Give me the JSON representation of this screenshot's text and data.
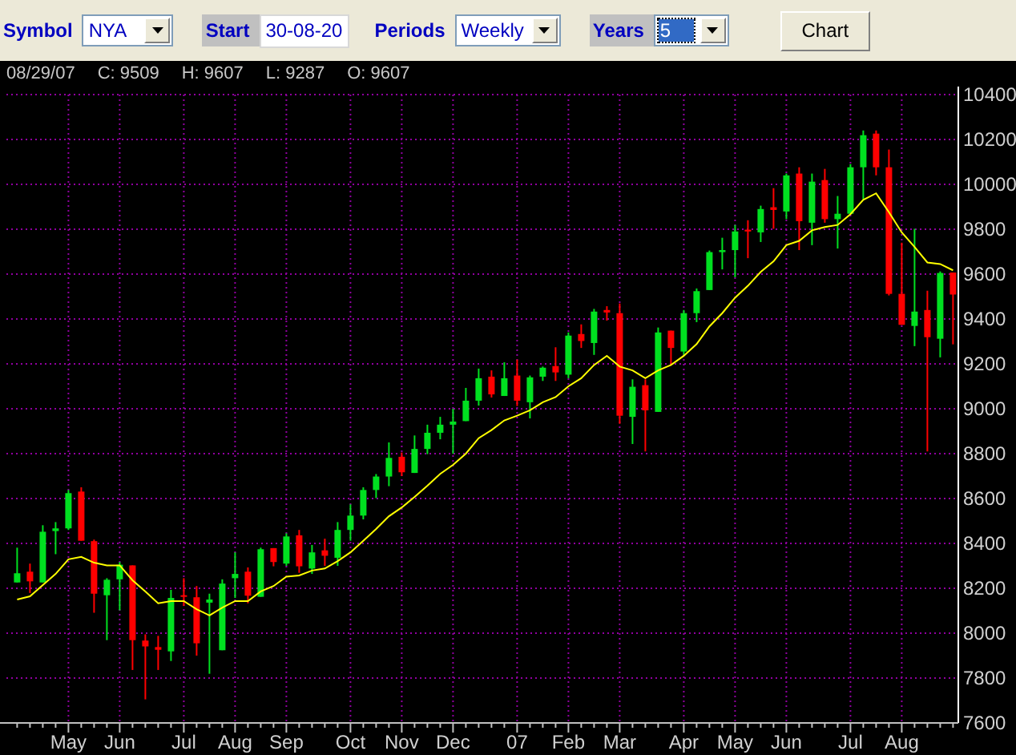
{
  "toolbar": {
    "controls": [
      {
        "kind": "label",
        "text": "Symbol",
        "shaded": false
      },
      {
        "kind": "select",
        "value": "NYA",
        "focused": false
      },
      {
        "kind": "label",
        "text": "Start",
        "shaded": true
      },
      {
        "kind": "input",
        "value": "30-08-20"
      },
      {
        "kind": "label",
        "text": "Periods",
        "shaded": false
      },
      {
        "kind": "select",
        "value": "Weekly",
        "focused": false
      },
      {
        "kind": "label",
        "text": "Years",
        "shaded": true
      },
      {
        "kind": "select",
        "value": "5",
        "focused": true
      },
      {
        "kind": "button",
        "text": "Chart"
      }
    ]
  },
  "info_bar": [
    "08/29/07",
    "C: 9509",
    "H: 9607",
    "L: 9287",
    "O: 9607"
  ],
  "chart": {
    "chart_data": {
      "type": "candlestick",
      "categories": [
        null,
        null,
        null,
        null,
        "May",
        null,
        null,
        null,
        "Jun",
        null,
        null,
        null,
        null,
        "Jul",
        null,
        null,
        null,
        "Aug",
        null,
        null,
        null,
        "Sep",
        null,
        null,
        null,
        null,
        "Oct",
        null,
        null,
        null,
        "Nov",
        null,
        null,
        null,
        "Dec",
        null,
        null,
        null,
        null,
        "07",
        null,
        null,
        null,
        "Feb",
        null,
        null,
        null,
        "Mar",
        null,
        null,
        null,
        null,
        "Apr",
        null,
        null,
        null,
        "May",
        null,
        null,
        null,
        "Jun",
        null,
        null,
        null,
        null,
        "Jul",
        null,
        null,
        null,
        "Aug",
        null,
        null,
        null,
        null
      ],
      "ylim": [
        7600,
        10400
      ],
      "grid": true,
      "yticks": [
        7600,
        7800,
        8000,
        8200,
        8400,
        8600,
        8800,
        9000,
        9200,
        9400,
        9600,
        9800,
        10000,
        10200,
        10400
      ],
      "ohlc": [
        [
          8226,
          8381,
          8226,
          8267
        ],
        [
          8274,
          8310,
          8179,
          8231
        ],
        [
          8226,
          8481,
          8226,
          8452
        ],
        [
          8455,
          8495,
          8352,
          8467
        ],
        [
          8467,
          8638,
          8460,
          8624
        ],
        [
          8631,
          8650,
          8412,
          8412
        ],
        [
          8410,
          8417,
          8091,
          8176
        ],
        [
          8169,
          8245,
          7969,
          8238
        ],
        [
          8240,
          8317,
          8102,
          8305
        ],
        [
          8302,
          8302,
          7836,
          7969
        ],
        [
          7967,
          7995,
          7705,
          7941
        ],
        [
          7938,
          7988,
          7836,
          7926
        ],
        [
          7919,
          8193,
          7876,
          8157
        ],
        [
          8169,
          8245,
          8121,
          8164
        ],
        [
          8160,
          8210,
          7900,
          7955
        ],
        [
          8136,
          8176,
          7819,
          8150
        ],
        [
          7924,
          8240,
          7924,
          8221
        ],
        [
          8245,
          8360,
          8157,
          8264
        ],
        [
          8274,
          8293,
          8133,
          8167
        ],
        [
          8162,
          8381,
          8162,
          8374
        ],
        [
          8379,
          8379,
          8298,
          8317
        ],
        [
          8310,
          8445,
          8300,
          8431
        ],
        [
          8436,
          8460,
          8269,
          8298
        ],
        [
          8288,
          8393,
          8264,
          8360
        ],
        [
          8369,
          8421,
          8300,
          8345
        ],
        [
          8336,
          8495,
          8300,
          8460
        ],
        [
          8460,
          8574,
          8412,
          8524
        ],
        [
          8524,
          8650,
          8507,
          8638
        ],
        [
          8638,
          8709,
          8602,
          8698
        ],
        [
          8698,
          8850,
          8655,
          8781
        ],
        [
          8786,
          8805,
          8700,
          8717
        ],
        [
          8714,
          8881,
          8714,
          8821
        ],
        [
          8821,
          8929,
          8798,
          8893
        ],
        [
          8893,
          8964,
          8864,
          8929
        ],
        [
          8929,
          9000,
          8800,
          8943
        ],
        [
          8945,
          9093,
          8945,
          9036
        ],
        [
          9036,
          9179,
          9014,
          9136
        ],
        [
          9143,
          9171,
          9050,
          9064
        ],
        [
          9057,
          9207,
          9057,
          9136
        ],
        [
          9148,
          9219,
          9012,
          9036
        ],
        [
          9029,
          9148,
          8957,
          9140
        ],
        [
          9143,
          9188,
          9124,
          9183
        ],
        [
          9190,
          9274,
          9124,
          9162
        ],
        [
          9152,
          9340,
          9136,
          9326
        ],
        [
          9333,
          9376,
          9271,
          9302
        ],
        [
          9293,
          9445,
          9240,
          9433
        ],
        [
          9440,
          9457,
          9393,
          9429
        ],
        [
          9426,
          9469,
          8933,
          8969
        ],
        [
          8964,
          9131,
          8843,
          9098
        ],
        [
          9105,
          9131,
          8810,
          8993
        ],
        [
          8986,
          9362,
          8986,
          9340
        ],
        [
          9348,
          9348,
          9195,
          9271
        ],
        [
          9255,
          9440,
          9240,
          9426
        ],
        [
          9426,
          9536,
          9386,
          9524
        ],
        [
          9529,
          9705,
          9529,
          9698
        ],
        [
          9698,
          9762,
          9621,
          9707
        ],
        [
          9707,
          9819,
          9586,
          9790
        ],
        [
          9798,
          9840,
          9671,
          9790
        ],
        [
          9786,
          9905,
          9743,
          9890
        ],
        [
          9898,
          9983,
          9802,
          9886
        ],
        [
          9879,
          10048,
          9845,
          10040
        ],
        [
          10048,
          10076,
          9707,
          9836
        ],
        [
          9829,
          10048,
          9729,
          10012
        ],
        [
          10019,
          10069,
          9829,
          9845
        ],
        [
          9845,
          9948,
          9714,
          9869
        ],
        [
          9869,
          10090,
          9869,
          10076
        ],
        [
          10076,
          10240,
          9933,
          10219
        ],
        [
          10226,
          10240,
          10040,
          10076
        ],
        [
          10076,
          10155,
          9505,
          9512
        ],
        [
          9512,
          9740,
          9374,
          9374
        ],
        [
          9369,
          9802,
          9279,
          9433
        ],
        [
          9440,
          9526,
          8810,
          9319
        ],
        [
          9312,
          9612,
          9229,
          9605
        ],
        [
          9607,
          9607,
          9287,
          9509
        ]
      ],
      "series": [
        {
          "type": "line",
          "color": "#ffff00",
          "values": [
            8150,
            8164,
            8214,
            8264,
            8329,
            8340,
            8314,
            8302,
            8302,
            8236,
            8186,
            8133,
            8143,
            8143,
            8107,
            8079,
            8114,
            8143,
            8143,
            8186,
            8210,
            8252,
            8257,
            8279,
            8288,
            8321,
            8360,
            8412,
            8464,
            8521,
            8560,
            8607,
            8657,
            8710,
            8750,
            8800,
            8869,
            8905,
            8948,
            8969,
            8993,
            9029,
            9052,
            9100,
            9136,
            9195,
            9236,
            9188,
            9171,
            9136,
            9171,
            9195,
            9236,
            9288,
            9367,
            9426,
            9495,
            9548,
            9610,
            9657,
            9729,
            9748,
            9795,
            9810,
            9819,
            9867,
            9931,
            9960,
            9876,
            9786,
            9721,
            9652,
            9645,
            9617
          ]
        }
      ]
    }
  }
}
